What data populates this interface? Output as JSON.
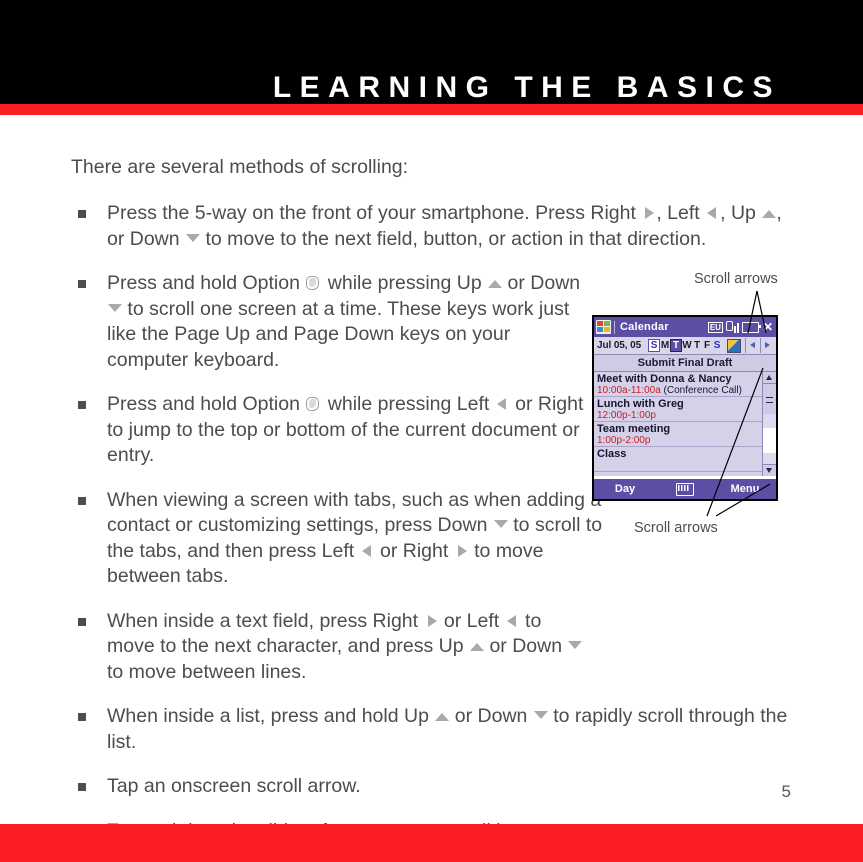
{
  "header": {
    "title": "LEARNING THE BASICS",
    "rule_color": "#fb1e25",
    "background_color": "#000000"
  },
  "footer": {
    "page_number": "5",
    "rule_color": "#fb1e25"
  },
  "body": {
    "intro": "There are several methods of scrolling:",
    "bullets": [
      {
        "id": "bullet-5way",
        "parts": [
          {
            "t": "text",
            "v": "Press the 5-way on the front of your smartphone. Press Right "
          },
          {
            "t": "icon",
            "v": "right-arrow-key-icon"
          },
          {
            "t": "text",
            "v": ", Left "
          },
          {
            "t": "icon",
            "v": "left-arrow-key-icon"
          },
          {
            "t": "text",
            "v": ", Up "
          },
          {
            "t": "icon",
            "v": "up-arrow-key-icon"
          },
          {
            "t": "text",
            "v": ", or Down "
          },
          {
            "t": "icon",
            "v": "down-arrow-key-icon"
          },
          {
            "t": "text",
            "v": " to move to the next field, button, or action in that direction."
          }
        ],
        "width": "w-wide"
      },
      {
        "id": "bullet-option-updown",
        "parts": [
          {
            "t": "text",
            "v": "Press and hold Option "
          },
          {
            "t": "icon",
            "v": "option-key-icon"
          },
          {
            "t": "text",
            "v": " while pressing Up "
          },
          {
            "t": "icon",
            "v": "up-arrow-key-icon"
          },
          {
            "t": "text",
            "v": " or Down "
          },
          {
            "t": "icon",
            "v": "down-arrow-key-icon"
          },
          {
            "t": "text",
            "v": " to scroll one screen at a time. These keys work just like the Page Up and Page Down keys on your computer keyboard."
          }
        ],
        "width": "w-narrow"
      },
      {
        "id": "bullet-option-leftright",
        "parts": [
          {
            "t": "text",
            "v": "Press and hold Option "
          },
          {
            "t": "icon",
            "v": "option-key-icon"
          },
          {
            "t": "text",
            "v": " while pressing Left "
          },
          {
            "t": "icon",
            "v": "left-arrow-key-icon"
          },
          {
            "t": "text",
            "v": " or Right "
          },
          {
            "t": "icon",
            "v": "right-arrow-key-icon"
          },
          {
            "t": "text",
            "v": " to jump to the top or bottom of the current document or entry."
          }
        ],
        "width": "w-mid"
      },
      {
        "id": "bullet-tabs",
        "parts": [
          {
            "t": "text",
            "v": "When viewing a screen with tabs, such as when adding a contact or customizing settings, press Down "
          },
          {
            "t": "icon",
            "v": "down-arrow-key-icon"
          },
          {
            "t": "text",
            "v": " to scroll to the tabs, and then press Left "
          },
          {
            "t": "icon",
            "v": "left-arrow-key-icon"
          },
          {
            "t": "text",
            "v": " or Right "
          },
          {
            "t": "icon",
            "v": "right-arrow-key-icon"
          },
          {
            "t": "text",
            "v": " to move between tabs."
          }
        ],
        "width": "w-mid"
      },
      {
        "id": "bullet-textfield",
        "parts": [
          {
            "t": "text",
            "v": "When inside a text field, press Right "
          },
          {
            "t": "icon",
            "v": "right-arrow-key-icon"
          },
          {
            "t": "text",
            "v": " or Left "
          },
          {
            "t": "icon",
            "v": "left-arrow-key-icon"
          },
          {
            "t": "text",
            "v": " to move to the next character, and press Up "
          },
          {
            "t": "icon",
            "v": "up-arrow-key-icon"
          },
          {
            "t": "text",
            "v": " or Down "
          },
          {
            "t": "icon",
            "v": "down-arrow-key-icon"
          },
          {
            "t": "text",
            "v": " to move between lines."
          }
        ],
        "width": "w-narrow"
      },
      {
        "id": "bullet-list",
        "parts": [
          {
            "t": "text",
            "v": "When inside a list, press and hold Up "
          },
          {
            "t": "icon",
            "v": "up-arrow-key-icon"
          },
          {
            "t": "text",
            "v": " or Down "
          },
          {
            "t": "icon",
            "v": "down-arrow-key-icon"
          },
          {
            "t": "text",
            "v": " to rapidly scroll through the list."
          }
        ],
        "width": "w-wide"
      },
      {
        "id": "bullet-tap-arrow",
        "parts": [
          {
            "t": "text",
            "v": "Tap an onscreen scroll arrow."
          }
        ],
        "width": "w-wide"
      },
      {
        "id": "bullet-tap-drag",
        "parts": [
          {
            "t": "text",
            "v": "Tap and drag the slider of an onscreen scroll bar."
          }
        ],
        "width": "w-wide"
      }
    ]
  },
  "figure": {
    "callout_top_label": "Scroll arrows",
    "callout_bottom_label": "Scroll arrows",
    "device_screen": {
      "titlebar": {
        "app_title": "Calendar",
        "status_icons": [
          "start-menu-icon",
          "eu-input-indicator",
          "signal-strength-icon",
          "battery-icon",
          "close-icon"
        ],
        "eu_label": "EU",
        "close_label": "✕",
        "background_color": "#5c4ea5"
      },
      "datebar": {
        "date": "Jul 05, 05",
        "day_letters": [
          "S",
          "M",
          "T",
          "W",
          "T",
          "F",
          "S"
        ],
        "selected_day_index": 2,
        "prev_label": "prev-day-arrow-icon",
        "next_label": "next-day-arrow-icon"
      },
      "all_day_event": "Submit Final Draft",
      "appointments": [
        {
          "title": "Meet with Donna & Nancy",
          "time": "10:00a-11:00a",
          "note": "(Conference Call)"
        },
        {
          "title": "Lunch with Greg",
          "time": "12:00p-1:00p",
          "note": ""
        },
        {
          "title": "Team meeting",
          "time": "1:00p-2:00p",
          "note": ""
        },
        {
          "title": "Class",
          "time": "",
          "note": ""
        }
      ],
      "softkeys": {
        "left": "Day",
        "middle": "keyboard-icon",
        "right": "Menu"
      }
    }
  }
}
